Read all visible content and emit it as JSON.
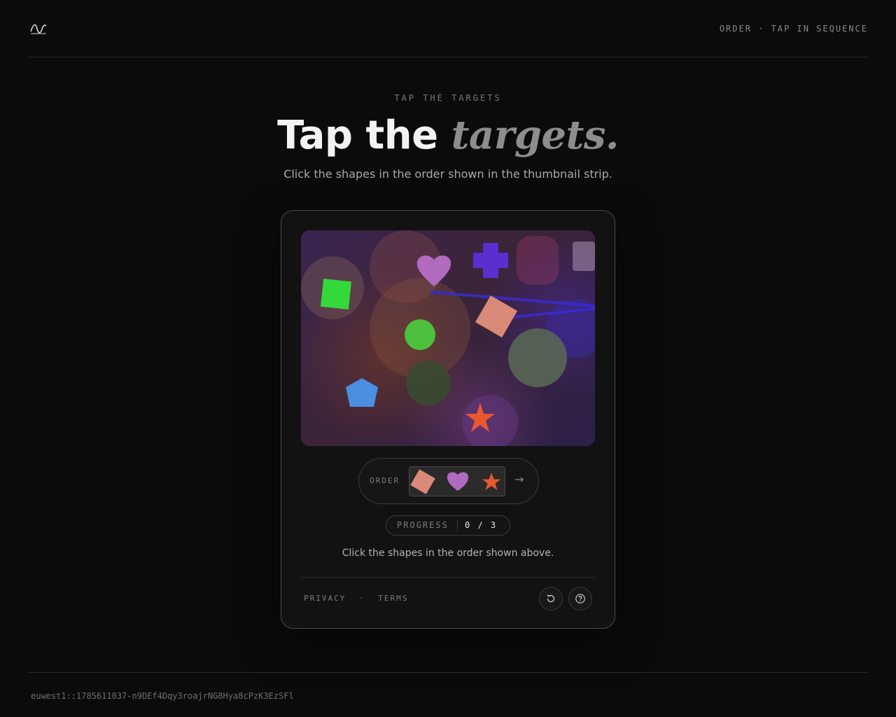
{
  "header": {
    "nav_text": "ORDER · TAP IN SEQUENCE"
  },
  "hero": {
    "eyebrow": "TAP THE TARGETS",
    "title_plain": "Tap the ",
    "title_emphasis": "targets.",
    "subtitle": "Click the shapes in the order shown in the thumbnail strip."
  },
  "challenge": {
    "shapes": [
      {
        "name": "green-square-shape",
        "color": "#33d93a"
      },
      {
        "name": "pink-heart-shape",
        "color": "#b06bbf"
      },
      {
        "name": "purple-cross-shape",
        "color": "#5a2fd0"
      },
      {
        "name": "green-circle-shape",
        "color": "#4cbf3c"
      },
      {
        "name": "salmon-diamond-shape",
        "color": "#d98a78"
      },
      {
        "name": "blue-pentagon-shape",
        "color": "#4a8fe0"
      },
      {
        "name": "orange-star-shape",
        "color": "#e8582e"
      }
    ],
    "order_label": "ORDER",
    "order_sequence": [
      "salmon-diamond",
      "pink-heart",
      "orange-star"
    ],
    "progress_label": "PROGRESS",
    "progress_value": "0 / 3",
    "instruction": "Click the shapes in the order shown above."
  },
  "footer_links": {
    "privacy": "PRIVACY",
    "separator": "·",
    "terms": "TERMS"
  },
  "icons": {
    "logo": "wave-logo-icon",
    "refresh": "refresh-icon",
    "help": "help-icon",
    "next": "arrow-right-icon"
  },
  "session_id": "euwest1::1785611037-n9DEf4Dqy3roajrNG8Hya8cPzK3EzSFl"
}
